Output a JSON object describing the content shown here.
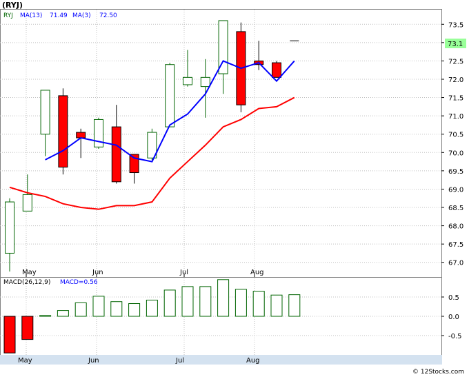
{
  "header": {
    "title": "(RYJ)",
    "legend_symbol": "RYJ",
    "ma13_label": "MA(13)",
    "ma13_value": "71.49",
    "ma3_label": "MA(3)",
    "ma3_value": "72.50",
    "macd_label": "MACD(26,12,9)",
    "macd_value_label": "MACD=0.56",
    "last_price_tag": "73.1",
    "watermark": "© 12Stocks.com"
  },
  "colors": {
    "up": "#006400",
    "down": "#ff0000",
    "ma3": "#ff0000",
    "ma13": "#0000ff",
    "grid": "#c0c0c0",
    "tag_bg": "#99ff99"
  },
  "chart_data": [
    {
      "type": "candlestick",
      "title": "(RYJ)",
      "ylim": [
        66.6,
        73.9
      ],
      "y_ticks": [
        "67.0",
        "67.5",
        "68.0",
        "68.5",
        "69.0",
        "69.5",
        "70.0",
        "70.5",
        "71.0",
        "71.5",
        "72.0",
        "72.5",
        "73.0",
        "73.5"
      ],
      "x_ticks": [
        "May",
        "Jun",
        "Jul",
        "Aug"
      ],
      "candles": [
        {
          "o": 67.25,
          "h": 68.75,
          "l": 66.75,
          "c": 68.65
        },
        {
          "o": 68.4,
          "h": 69.4,
          "l": 68.4,
          "c": 68.85
        },
        {
          "o": 70.5,
          "h": 71.7,
          "l": 69.9,
          "c": 71.7
        },
        {
          "o": 71.55,
          "h": 71.75,
          "l": 69.4,
          "c": 69.6
        },
        {
          "o": 70.55,
          "h": 70.65,
          "l": 69.85,
          "c": 70.4
        },
        {
          "o": 70.15,
          "h": 70.95,
          "l": 70.1,
          "c": 70.9
        },
        {
          "o": 70.7,
          "h": 71.3,
          "l": 69.15,
          "c": 69.2
        },
        {
          "o": 69.95,
          "h": 69.95,
          "l": 69.15,
          "c": 69.45
        },
        {
          "o": 69.85,
          "h": 70.65,
          "l": 69.8,
          "c": 70.55
        },
        {
          "o": 70.7,
          "h": 72.45,
          "l": 70.7,
          "c": 72.4
        },
        {
          "o": 71.85,
          "h": 72.8,
          "l": 71.8,
          "c": 72.05
        },
        {
          "o": 71.8,
          "h": 72.55,
          "l": 70.95,
          "c": 72.05
        },
        {
          "o": 72.15,
          "h": 73.6,
          "l": 71.6,
          "c": 73.6
        },
        {
          "o": 73.3,
          "h": 73.55,
          "l": 71.1,
          "c": 71.3
        },
        {
          "o": 72.5,
          "h": 73.05,
          "l": 72.25,
          "c": 72.4
        },
        {
          "o": 72.45,
          "h": 72.5,
          "l": 72.05,
          "c": 72.05
        },
        {
          "o": 73.05,
          "h": 73.05,
          "l": 73.05,
          "c": 73.05
        }
      ],
      "series": [
        {
          "name": "MA(3)",
          "values": [
            69.05,
            68.9,
            68.8,
            68.6,
            68.5,
            68.45,
            68.55,
            68.55,
            68.65,
            69.3,
            69.75,
            70.2,
            70.7,
            70.9,
            71.2,
            71.25,
            71.5
          ]
        },
        {
          "name": "MA(13)",
          "values": [
            null,
            null,
            69.8,
            70.05,
            70.4,
            70.3,
            70.2,
            69.85,
            69.75,
            70.75,
            71.05,
            71.6,
            72.5,
            72.3,
            72.45,
            71.95,
            72.5
          ]
        }
      ],
      "last_value": 73.1
    },
    {
      "type": "bar",
      "title": "MACD(26,12,9)",
      "ylim": [
        -1.0,
        1.0
      ],
      "y_ticks": [
        "0.5",
        "0.0",
        "-0.5"
      ],
      "x_ticks": [
        "May",
        "Jun",
        "Jul",
        "Aug"
      ],
      "values": [
        -0.95,
        -0.6,
        0.02,
        0.15,
        0.35,
        0.52,
        0.38,
        0.33,
        0.42,
        0.68,
        0.77,
        0.77,
        0.95,
        0.7,
        0.65,
        0.55,
        0.56
      ]
    }
  ]
}
